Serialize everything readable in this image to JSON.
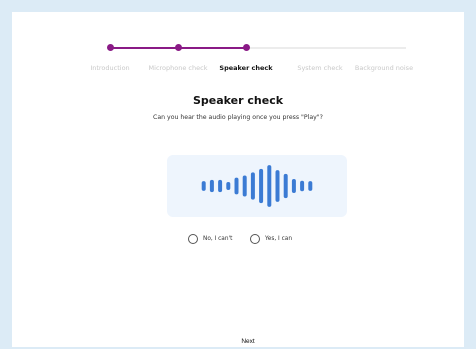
{
  "stepper": {
    "steps": [
      {
        "label": "Introduction"
      },
      {
        "label": "Microphone check"
      },
      {
        "label": "Speaker check"
      },
      {
        "label": "System check"
      },
      {
        "label": "Background noise"
      }
    ],
    "active_index": 2
  },
  "title": "Speaker check",
  "subtitle": "Can you hear the audio playing once you press \"Play\"?",
  "player": {
    "bar_levels": [
      0.22,
      0.28,
      0.28,
      0.18,
      0.38,
      0.48,
      0.62,
      0.78,
      0.95,
      0.72,
      0.55,
      0.32,
      0.24,
      0.22
    ]
  },
  "options": [
    {
      "label": "No, I can't"
    },
    {
      "label": "Yes, I can"
    }
  ],
  "next_label": "Next",
  "colors": {
    "accent": "#8a1a86",
    "waveform": "#3b7bd4",
    "page_background": "#dcebf6"
  }
}
